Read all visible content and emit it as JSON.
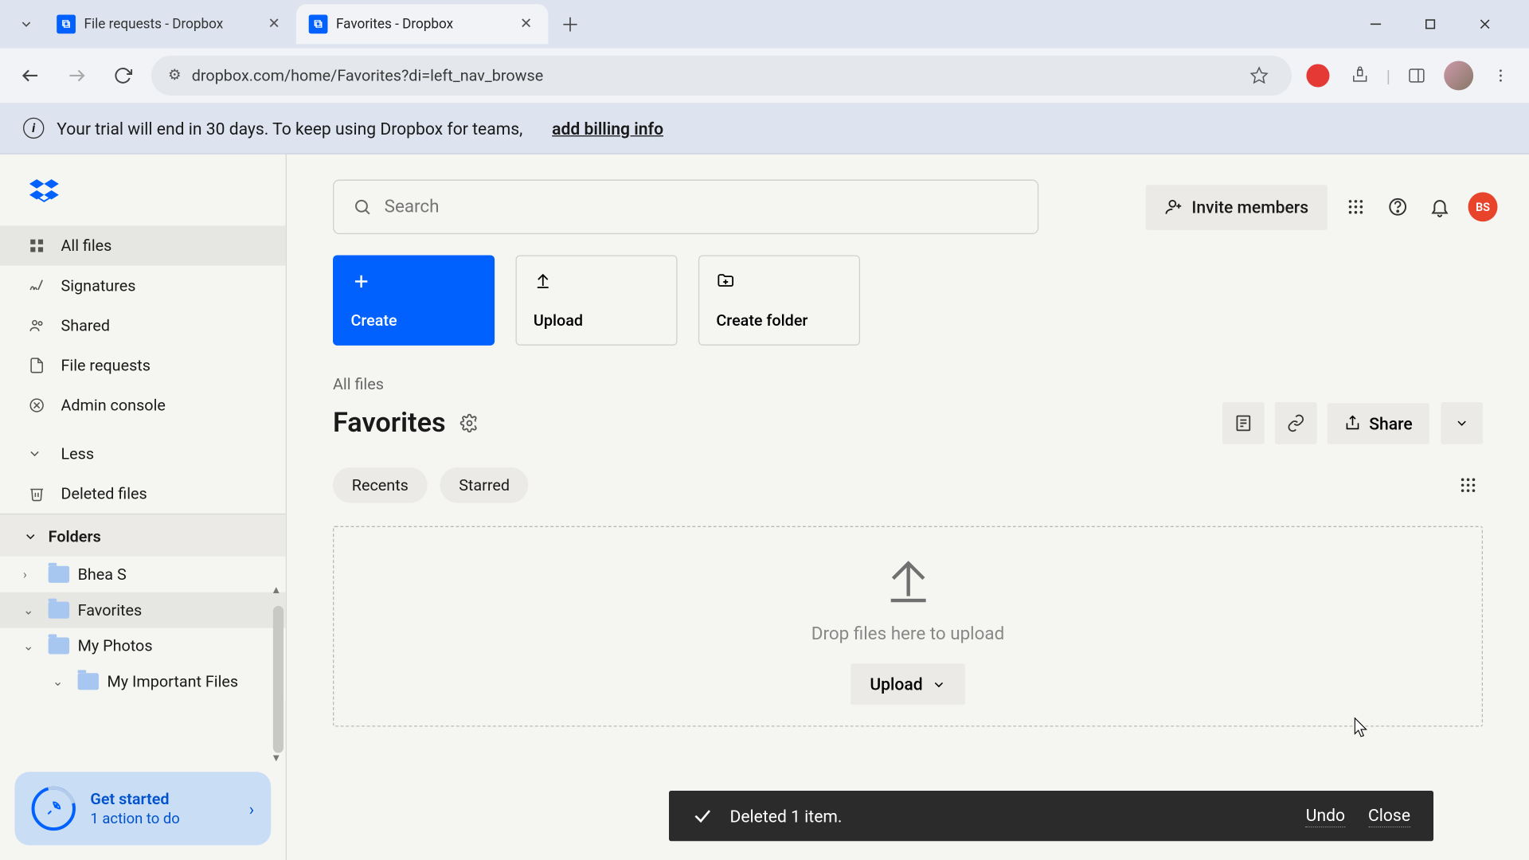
{
  "browser": {
    "tabs": [
      {
        "title": "File requests - Dropbox",
        "active": false
      },
      {
        "title": "Favorites - Dropbox",
        "active": true
      }
    ],
    "url": "dropbox.com/home/Favorites?di=left_nav_browse"
  },
  "trial_banner": {
    "message": "Your trial will end in 30 days. To keep using Dropbox for teams,",
    "link": "add billing info"
  },
  "sidebar": {
    "nav": [
      {
        "id": "all-files",
        "label": "All files",
        "active": true
      },
      {
        "id": "signatures",
        "label": "Signatures",
        "active": false
      },
      {
        "id": "shared",
        "label": "Shared",
        "active": false
      },
      {
        "id": "file-requests",
        "label": "File requests",
        "active": false
      },
      {
        "id": "admin-console",
        "label": "Admin console",
        "active": false
      }
    ],
    "less_label": "Less",
    "deleted_label": "Deleted files",
    "folders_label": "Folders",
    "folders": [
      {
        "name": "Bhea S",
        "expanded": false,
        "selected": false,
        "depth": 0
      },
      {
        "name": "Favorites",
        "expanded": true,
        "selected": true,
        "depth": 0
      },
      {
        "name": "My Photos",
        "expanded": true,
        "selected": false,
        "depth": 0
      },
      {
        "name": "My Important Files",
        "expanded": true,
        "selected": false,
        "depth": 1
      }
    ],
    "get_started": {
      "title": "Get started",
      "subtitle": "1 action to do"
    }
  },
  "header": {
    "search_placeholder": "Search",
    "invite_label": "Invite members",
    "avatar_initials": "BS"
  },
  "actions": {
    "create": "Create",
    "upload": "Upload",
    "create_folder": "Create folder"
  },
  "breadcrumb": {
    "root": "All files"
  },
  "page": {
    "title": "Favorites",
    "chips": [
      "Recents",
      "Starred"
    ],
    "share_label": "Share",
    "dropzone_text": "Drop files here to upload",
    "dropzone_upload": "Upload"
  },
  "toast": {
    "message": "Deleted 1 item.",
    "undo": "Undo",
    "close": "Close"
  }
}
